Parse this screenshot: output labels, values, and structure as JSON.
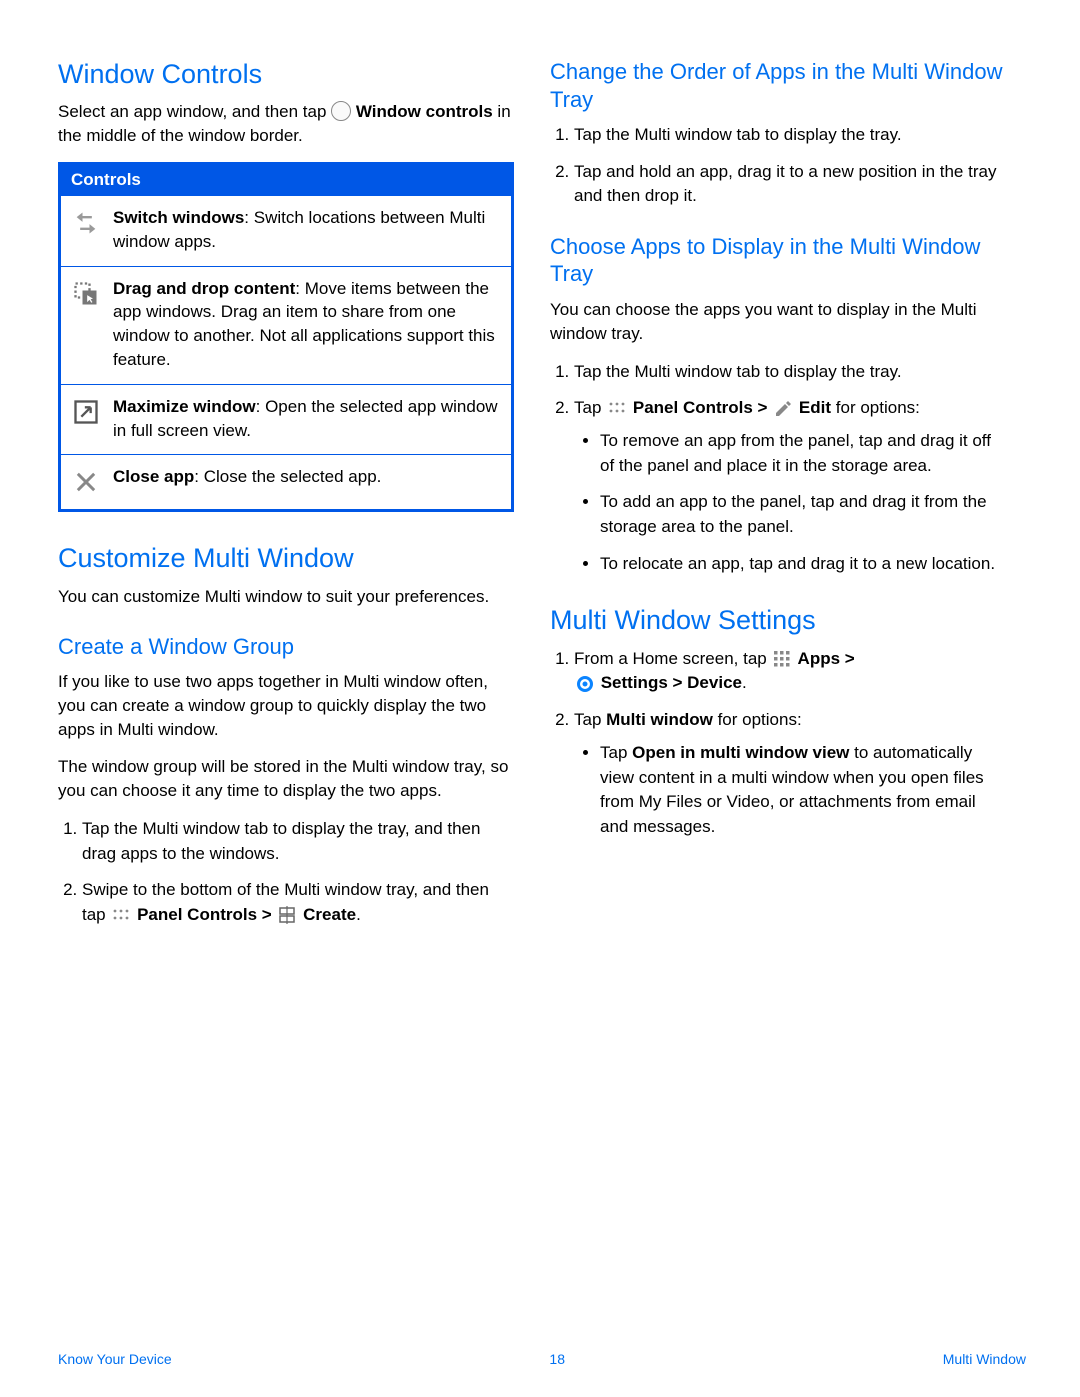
{
  "left": {
    "h_window_controls": "Window Controls",
    "p_intro_1": "Select an app window, and then tap",
    "p_intro_bold": " Window controls",
    "p_intro_2": " in the middle of the window border.",
    "controls_header": "Controls",
    "row1_bold": "Switch windows",
    "row1_text": ": Switch locations between Multi window apps.",
    "row2_bold": "Drag and drop content",
    "row2_text": ": Move items between the app windows. Drag an item to share from one window to another. Not all applications support this feature.",
    "row3_bold": "Maximize window",
    "row3_text": ": Open the selected app window in full screen view.",
    "row4_bold": "Close app",
    "row4_text": ": Close the selected app.",
    "h_customize": "Customize Multi Window",
    "p_customize": "You can customize Multi window to suit your preferences.",
    "h_create_group": "Create a Window Group",
    "p_group_1": "If you like to use two apps together in Multi window often, you can create a window group to quickly display the two apps in Multi window.",
    "p_group_2": "The window group will be stored in the Multi window tray, so you can choose it any time to display the two apps.",
    "ol_group_1": "Tap the Multi window tab to display the tray, and then drag apps to the windows.",
    "ol_group_2a": "Swipe to the bottom of the Multi window tray, and then tap ",
    "ol_group_2_panel": " Panel Controls > ",
    "ol_group_2_create": " Create",
    "period": "."
  },
  "right": {
    "h_change_order": "Change the Order of Apps in the Multi Window Tray",
    "ol_change_1": "Tap the Multi window tab to display the tray.",
    "ol_change_2": "Tap and hold an app, drag it to a new position in the tray and then drop it.",
    "h_choose_apps": "Choose Apps to Display in the Multi Window Tray",
    "p_choose": "You can choose the apps you want to display in the Multi window tray.",
    "ol_choose_1": "Tap the Multi window tab to display the tray.",
    "ol_choose_2a": "Tap ",
    "ol_choose_2_panel": " Panel Controls > ",
    "ol_choose_2_edit": " Edit",
    "ol_choose_2b": " for options:",
    "ul_choose_a": "To remove an app from the panel, tap and drag it off of the panel and place it in the storage area.",
    "ul_choose_b": "To add an app to the panel, tap and drag it from the storage area to the panel.",
    "ul_choose_c": "To relocate an app, tap and drag it to a new location.",
    "h_mw_settings": "Multi Window Settings",
    "ol_set_1a": "From a Home screen, tap ",
    "ol_set_1_apps": " Apps > ",
    "ol_set_1_settings": " Settings > Device",
    "ol_set_2a": "Tap ",
    "ol_set_2_mw": "Multi window",
    "ol_set_2b": " for options:",
    "ul_set_a_pre": "Tap ",
    "ul_set_a_bold": "Open in multi window view",
    "ul_set_a_post": " to automatically view content in a multi window when you open files from My Files or Video, or attachments from email and messages."
  },
  "footer": {
    "left": "Know Your Device",
    "center": "18",
    "right": "Multi Window"
  }
}
